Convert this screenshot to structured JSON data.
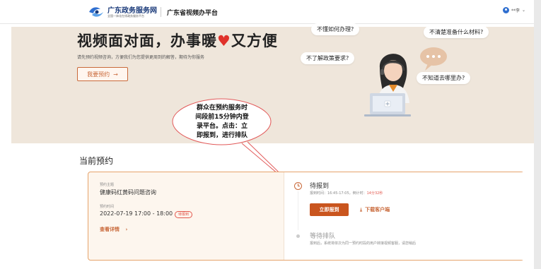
{
  "header": {
    "logo_title": "广东政务服务网",
    "logo_subtitle": "全国一体化在线政务服务平台",
    "platform_name": "广东省视频办平台",
    "user_name": "**李",
    "user_caret": "⌄"
  },
  "hero": {
    "title_part1": "视频面对面，办事暖",
    "title_heart": "♥",
    "title_part2": "又方便",
    "description": "请先预约视频咨询，方便我们为您提供更周到的解答，期待为你服务",
    "book_button": "我要预约",
    "book_arrow": "→",
    "bubbles": [
      "不懂如何办理?",
      "不清楚准备什么材料?",
      "不了解政策要求?",
      "不知道去哪里办?"
    ]
  },
  "callout": {
    "lines": [
      "群众在预约服务时",
      "间段前15分钟内登",
      "录平台。点击：立",
      "即报到，进行排队"
    ]
  },
  "current": {
    "section_title": "当前预约",
    "topic_label": "预约主题",
    "topic_value": "健康码红黄码问题咨询",
    "time_label": "预约时间",
    "time_value": "2022-07-19 17:00 - 18:00",
    "status_tag": "待报到",
    "detail_link": "查看详情",
    "detail_arrow": "›",
    "stage1_title": "待报到",
    "stage1_sub": "报到时间：16:45-17:05，倒计时：",
    "stage1_countdown": "14分32秒",
    "checkin_button": "立即报到",
    "download_icon": "⤓",
    "download_link": "下载客户端",
    "stage2_title": "等待排队",
    "stage2_sub": "报到后，系统将依次为同一预约时段的用户转接视频客服，请您稍后"
  },
  "colors": {
    "accent": "#c9551e",
    "hero_bg": "#efe6db",
    "card_border": "#e6a36b",
    "alert_red": "#e3564b"
  }
}
